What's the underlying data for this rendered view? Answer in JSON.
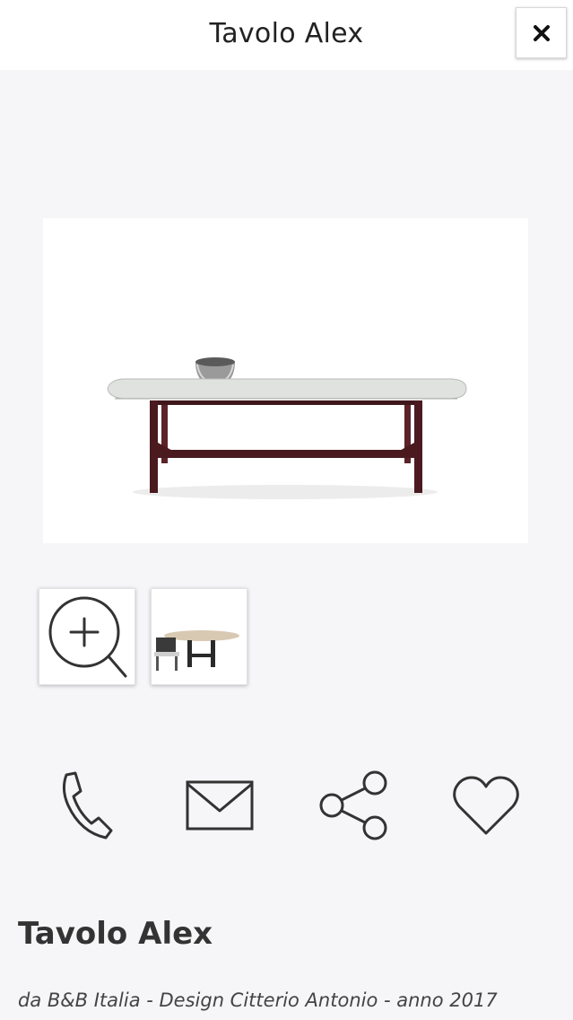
{
  "header": {
    "title": "Tavolo Alex",
    "close_icon": "close-icon"
  },
  "gallery": {
    "main_image": "coffee-table-photo",
    "thumbnails": [
      {
        "type": "zoom",
        "icon": "zoom-in-icon"
      },
      {
        "type": "photo",
        "image": "oval-table-with-chair-photo"
      }
    ]
  },
  "actions": [
    {
      "name": "call",
      "icon": "phone-icon"
    },
    {
      "name": "email",
      "icon": "envelope-icon"
    },
    {
      "name": "share",
      "icon": "share-icon"
    },
    {
      "name": "favorite",
      "icon": "heart-icon"
    }
  ],
  "product": {
    "name": "Tavolo Alex",
    "subtitle": "da B&B Italia - Design Citterio Antonio - anno 2017"
  }
}
